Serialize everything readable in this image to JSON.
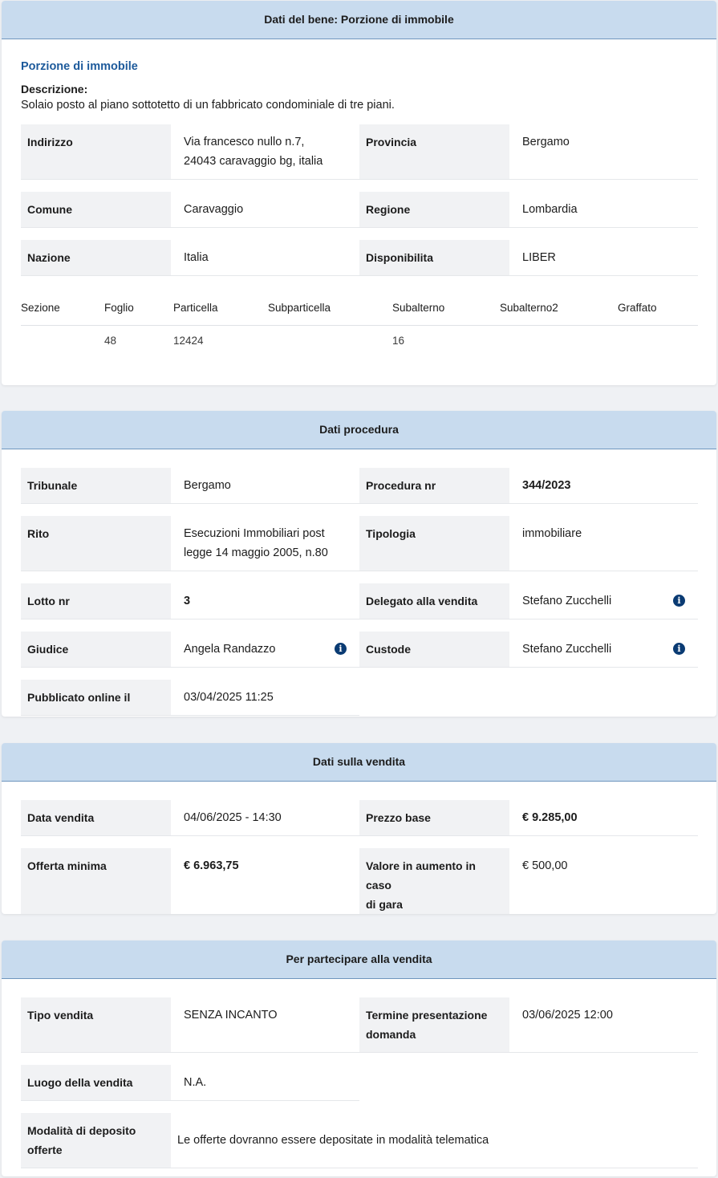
{
  "bene": {
    "header": "Dati del bene: Porzione di immobile",
    "title": "Porzione di immobile",
    "desc_label": "Descrizione:",
    "desc_text": "Solaio posto al piano sottotetto di un fabbricato condominiale di tre piani.",
    "indirizzo_label": "Indirizzo",
    "indirizzo_line1": "Via francesco nullo n.7,",
    "indirizzo_line2": "24043 caravaggio bg, italia",
    "provincia_label": "Provincia",
    "provincia_value": "Bergamo",
    "comune_label": "Comune",
    "comune_value": "Caravaggio",
    "regione_label": "Regione",
    "regione_value": "Lombardia",
    "nazione_label": "Nazione",
    "nazione_value": "Italia",
    "disponibilita_label": "Disponibilita",
    "disponibilita_value": "LIBER",
    "catasto_headers": [
      "Sezione",
      "Foglio",
      "Particella",
      "Subparticella",
      "Subalterno",
      "Subalterno2",
      "Graffato"
    ],
    "catasto_row": [
      "",
      "48",
      "12424",
      "",
      "16",
      "",
      ""
    ]
  },
  "procedura": {
    "header": "Dati procedura",
    "tribunale_label": "Tribunale",
    "tribunale_value": "Bergamo",
    "procedura_label": "Procedura nr",
    "procedura_value": "344/2023",
    "rito_label": "Rito",
    "rito_line1": "Esecuzioni Immobiliari post",
    "rito_line2": "legge 14 maggio 2005, n.80",
    "tipologia_label": "Tipologia",
    "tipologia_value": "immobiliare",
    "lotto_label": "Lotto nr",
    "lotto_value": "3",
    "delegato_label": "Delegato alla vendita",
    "delegato_value": "Stefano Zucchelli",
    "giudice_label": "Giudice",
    "giudice_value": "Angela Randazzo",
    "custode_label": "Custode",
    "custode_value": "Stefano Zucchelli",
    "pubblicato_label": "Pubblicato online il",
    "pubblicato_value": "03/04/2025 11:25"
  },
  "vendita": {
    "header": "Dati sulla vendita",
    "data_label": "Data vendita",
    "data_value": "04/06/2025 - 14:30",
    "prezzo_label": "Prezzo base",
    "prezzo_value": "€ 9.285,00",
    "offerta_label": "Offerta minima",
    "offerta_value": "€ 6.963,75",
    "aumento_line1": "Valore in aumento in caso",
    "aumento_line2": "di gara",
    "aumento_value": "€ 500,00"
  },
  "partecipare": {
    "header": "Per partecipare alla vendita",
    "tipo_label": "Tipo vendita",
    "tipo_value": "SENZA INCANTO",
    "termine_line1": "Termine presentazione",
    "termine_line2": "domanda",
    "termine_value": "03/06/2025 12:00",
    "luogo_label": "Luogo della vendita",
    "luogo_value": "N.A.",
    "deposito_line1": "Modalità di deposito",
    "deposito_line2": "offerte",
    "deposito_value": "Le offerte dovranno essere depositate in modalità telematica"
  },
  "colors": {
    "header_bg": "#c8dbee",
    "accent": "#1d5a9b",
    "icon": "#0a3b73"
  },
  "icons": {
    "info": "info-icon"
  }
}
